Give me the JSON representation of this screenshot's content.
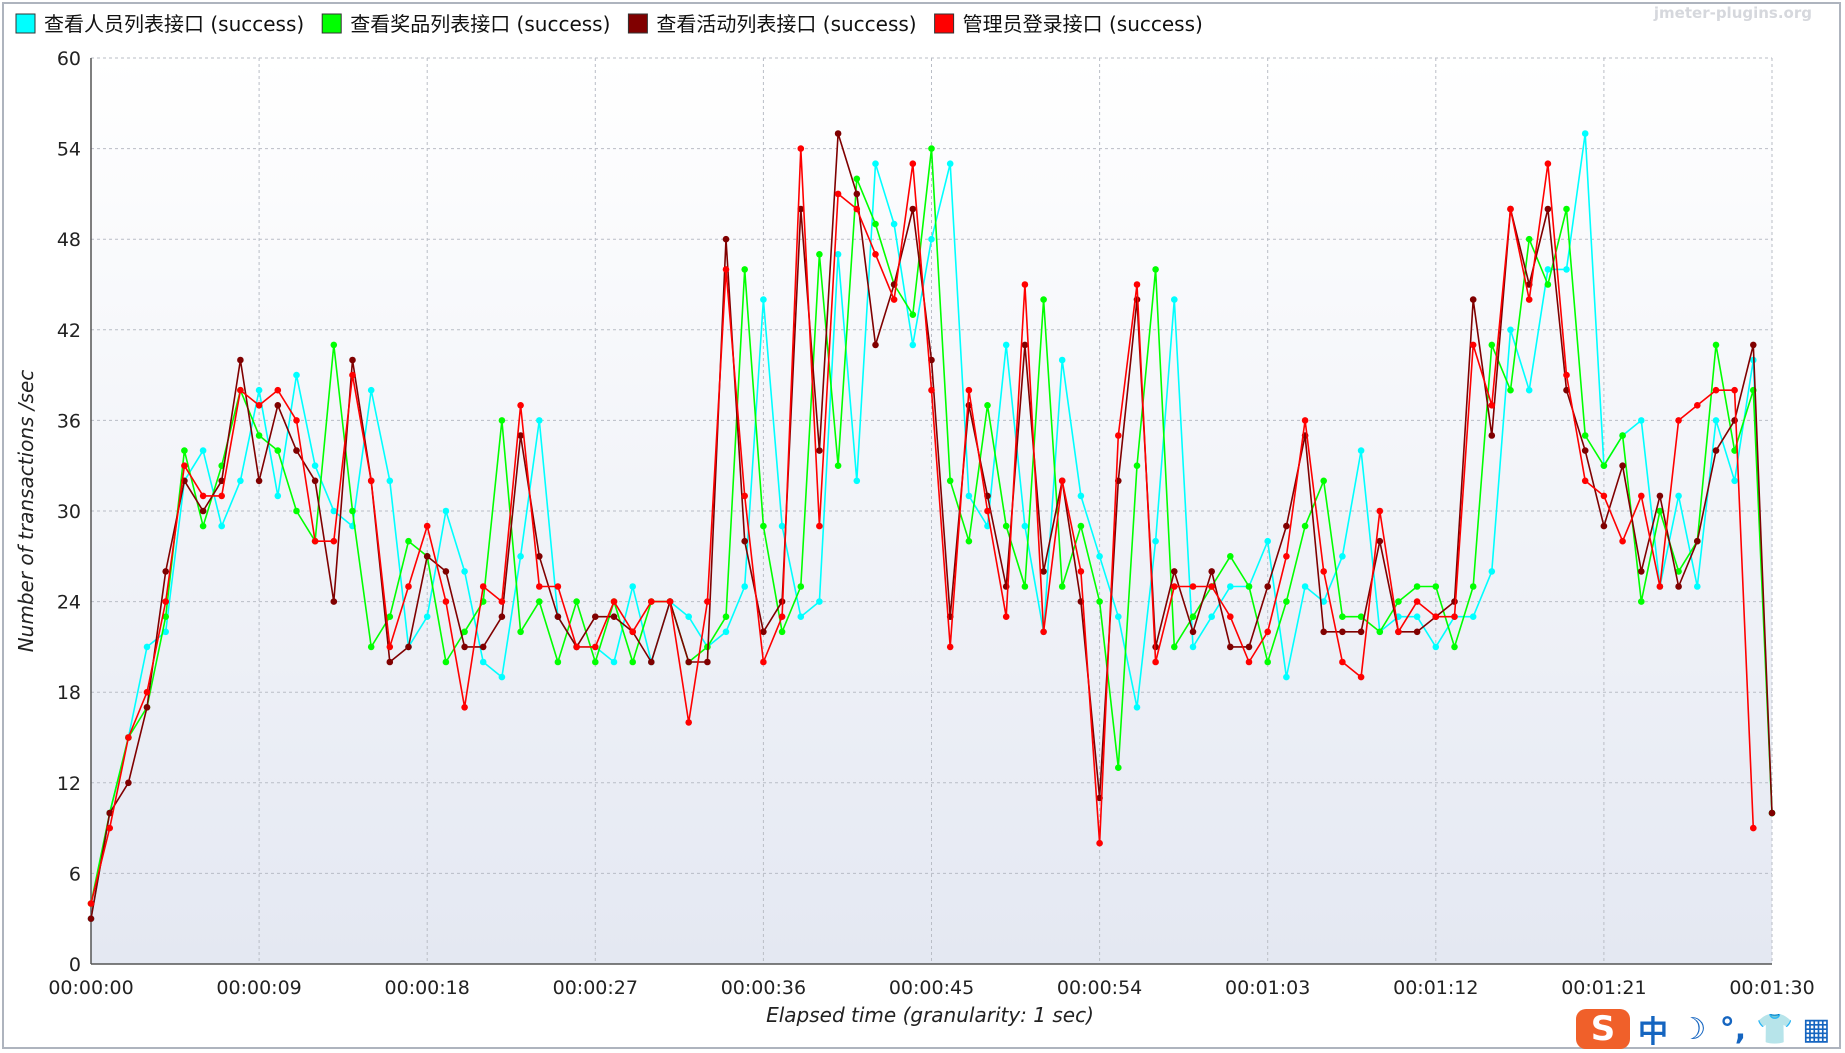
{
  "chart_data": {
    "type": "line",
    "title": "",
    "xlabel": "Elapsed time (granularity: 1 sec)",
    "ylabel": "Number of transactions /sec",
    "watermark": "jmeter-plugins.org",
    "ylim": [
      0,
      60
    ],
    "xlim": [
      "00:00:00",
      "00:01:30"
    ],
    "x_step_seconds": 1,
    "y_ticks": [
      0,
      6,
      12,
      18,
      24,
      30,
      36,
      42,
      48,
      54,
      60
    ],
    "x_ticks": [
      "00:00:00",
      "00:00:09",
      "00:00:18",
      "00:00:27",
      "00:00:36",
      "00:00:45",
      "00:00:54",
      "00:01:03",
      "00:01:12",
      "00:01:21",
      "00:01:30"
    ],
    "grid": true,
    "legend_position": "top",
    "series": [
      {
        "name": "查看人员列表接口 (success)",
        "color": "#00ffff",
        "values": [
          3,
          10,
          15,
          21,
          22,
          32,
          34,
          29,
          32,
          38,
          31,
          39,
          33,
          30,
          29,
          38,
          32,
          21,
          23,
          30,
          26,
          20,
          19,
          27,
          36,
          23,
          21,
          21,
          20,
          25,
          20,
          24,
          23,
          21,
          22,
          25,
          44,
          29,
          23,
          24,
          47,
          32,
          53,
          49,
          41,
          48,
          53,
          31,
          29,
          41,
          29,
          22,
          40,
          31,
          27,
          23,
          17,
          28,
          44,
          21,
          23,
          25,
          25,
          28,
          19,
          25,
          24,
          27,
          34,
          22,
          23,
          23,
          21,
          23,
          23,
          26,
          42,
          38,
          46,
          46,
          55,
          33,
          35,
          36,
          25,
          31,
          25,
          36,
          32,
          40,
          10
        ]
      },
      {
        "name": "查看奖品列表接口 (success)",
        "color": "#00ff00",
        "values": [
          4,
          10,
          15,
          17,
          23,
          34,
          29,
          33,
          38,
          35,
          34,
          30,
          28,
          41,
          30,
          21,
          23,
          28,
          27,
          20,
          22,
          24,
          36,
          22,
          24,
          20,
          24,
          20,
          24,
          20,
          24,
          24,
          20,
          21,
          23,
          46,
          29,
          22,
          25,
          47,
          33,
          52,
          49,
          45,
          43,
          54,
          32,
          28,
          37,
          29,
          25,
          44,
          25,
          29,
          24,
          13,
          33,
          46,
          21,
          23,
          25,
          27,
          25,
          20,
          24,
          29,
          32,
          23,
          23,
          22,
          24,
          25,
          25,
          21,
          25,
          41,
          38,
          48,
          45,
          50,
          35,
          33,
          35,
          24,
          30,
          26,
          28,
          41,
          34,
          38,
          10
        ]
      },
      {
        "name": "查看活动列表接口 (success)",
        "color": "#800000",
        "values": [
          3,
          10,
          12,
          17,
          26,
          32,
          30,
          32,
          40,
          32,
          37,
          34,
          32,
          24,
          40,
          32,
          20,
          21,
          27,
          26,
          21,
          21,
          23,
          35,
          27,
          23,
          21,
          23,
          23,
          22,
          20,
          24,
          20,
          20,
          48,
          28,
          22,
          24,
          50,
          34,
          55,
          51,
          41,
          45,
          50,
          40,
          23,
          37,
          31,
          25,
          41,
          26,
          32,
          24,
          11,
          32,
          44,
          21,
          26,
          22,
          26,
          21,
          21,
          25,
          29,
          35,
          22,
          22,
          22,
          28,
          22,
          22,
          23,
          24,
          44,
          35,
          50,
          45,
          50,
          38,
          34,
          29,
          33,
          26,
          31,
          25,
          28,
          34,
          36,
          41,
          10
        ]
      },
      {
        "name": "管理员登录接口 (success)",
        "color": "#ff0000",
        "values": [
          4,
          9,
          15,
          18,
          24,
          33,
          31,
          31,
          38,
          37,
          38,
          36,
          28,
          28,
          39,
          32,
          21,
          25,
          29,
          24,
          17,
          25,
          24,
          37,
          25,
          25,
          21,
          21,
          24,
          22,
          24,
          24,
          16,
          24,
          46,
          31,
          20,
          23,
          54,
          29,
          51,
          50,
          47,
          44,
          53,
          38,
          21,
          38,
          30,
          23,
          45,
          22,
          32,
          26,
          8,
          35,
          45,
          20,
          25,
          25,
          25,
          23,
          20,
          22,
          27,
          36,
          26,
          20,
          19,
          30,
          22,
          24,
          23,
          23,
          41,
          37,
          50,
          44,
          53,
          39,
          32,
          31,
          28,
          31,
          25,
          36,
          37,
          38,
          38,
          9
        ]
      }
    ]
  },
  "ime_toolbar": {
    "logo_text": "S",
    "items": [
      {
        "name": "chinese-mode-button",
        "text": "中"
      },
      {
        "name": "moon-icon",
        "text": "☽"
      },
      {
        "name": "punctuation-icon",
        "text": "°,"
      },
      {
        "name": "skin-icon",
        "text": "👕"
      },
      {
        "name": "toolbox-icon",
        "text": "▦"
      }
    ]
  }
}
